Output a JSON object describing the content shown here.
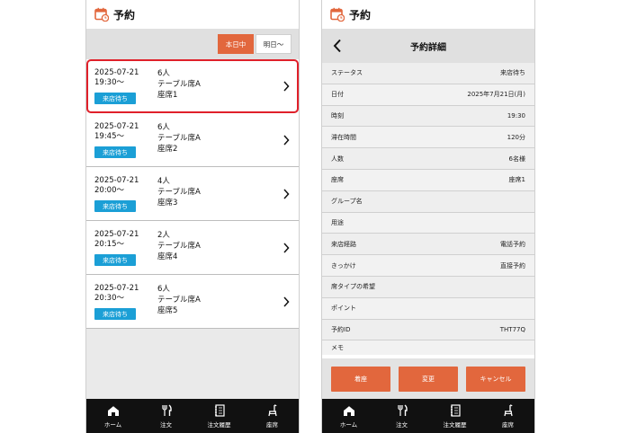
{
  "app": {
    "title": "予約"
  },
  "list_screen": {
    "filters": [
      {
        "label": "本日中",
        "active": true
      },
      {
        "label": "明日～",
        "active": false
      }
    ],
    "reservations": [
      {
        "date": "2025-07-21",
        "time": "19:30～",
        "status": "来店待ち",
        "party": "6人",
        "table_type": "テーブル席A",
        "seat": "座席1",
        "selected": true
      },
      {
        "date": "2025-07-21",
        "time": "19:45～",
        "status": "来店待ち",
        "party": "6人",
        "table_type": "テーブル席A",
        "seat": "座席2",
        "selected": false
      },
      {
        "date": "2025-07-21",
        "time": "20:00～",
        "status": "来店待ち",
        "party": "4人",
        "table_type": "テーブル席A",
        "seat": "座席3",
        "selected": false
      },
      {
        "date": "2025-07-21",
        "time": "20:15～",
        "status": "来店待ち",
        "party": "2人",
        "table_type": "テーブル席A",
        "seat": "座席4",
        "selected": false
      },
      {
        "date": "2025-07-21",
        "time": "20:30～",
        "status": "来店待ち",
        "party": "6人",
        "table_type": "テーブル席A",
        "seat": "座席5",
        "selected": false
      }
    ]
  },
  "detail_screen": {
    "title": "予約詳細",
    "rows": [
      {
        "label": "ステータス",
        "value": "来店待ち"
      },
      {
        "label": "日付",
        "value": "2025年7月21日(月)"
      },
      {
        "label": "時刻",
        "value": "19:30"
      },
      {
        "label": "滞在時間",
        "value": "120分"
      },
      {
        "label": "人数",
        "value": "6名様"
      },
      {
        "label": "座席",
        "value": "座席1"
      },
      {
        "label": "グループ名",
        "value": ""
      },
      {
        "label": "用途",
        "value": ""
      },
      {
        "label": "来店経路",
        "value": "電話予約"
      },
      {
        "label": "きっかけ",
        "value": "直接予約"
      },
      {
        "label": "席タイプの希望",
        "value": ""
      },
      {
        "label": "ポイント",
        "value": ""
      },
      {
        "label": "予約ID",
        "value": "THT77Q"
      },
      {
        "label": "メモ",
        "value": ""
      }
    ],
    "actions": {
      "arrive": "着座",
      "change": "変更",
      "cancel": "キャンセル"
    }
  },
  "tabs": [
    {
      "label": "ホーム",
      "icon": "home-icon"
    },
    {
      "label": "注文",
      "icon": "fork-knife-icon"
    },
    {
      "label": "注文履歴",
      "icon": "notebook-icon"
    },
    {
      "label": "座席",
      "icon": "chair-icon"
    }
  ],
  "colors": {
    "accent": "#e2673d",
    "badge": "#1b9fd6",
    "selected_outline": "#e0202a",
    "tab_bar": "#111111"
  }
}
